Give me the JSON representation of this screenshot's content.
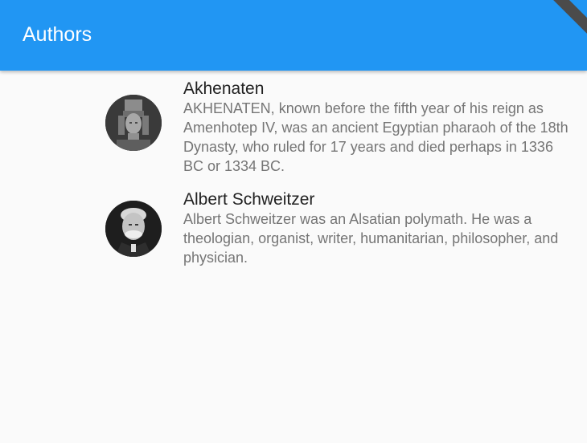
{
  "app_bar": {
    "title": "Authors",
    "color": "#2196f3"
  },
  "authors": [
    {
      "name": "Akhenaten",
      "description": "AKHENATEN, known before the fifth year of his reign as Amenhotep IV, was an ancient Egyptian pharaoh of the 18th Dynasty, who ruled for 17 years and died perhaps in 1336 BC or 1334 BC.",
      "avatar": "akhenaten-portrait"
    },
    {
      "name": "Albert Schweitzer",
      "description": "Albert Schweitzer was an Alsatian polymath. He was a theologian, organist, writer, humanitarian, philosopher, and physician.",
      "avatar": "schweitzer-portrait"
    }
  ]
}
